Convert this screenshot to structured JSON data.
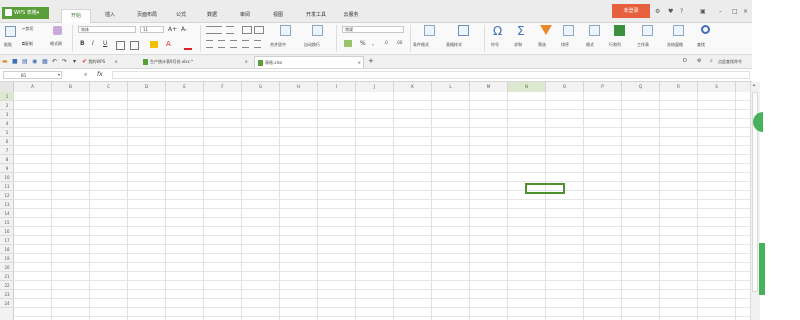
{
  "title_bar": {
    "app_label": "WPS 表格",
    "tabs": [
      "开始",
      "插入",
      "页面布局",
      "公式",
      "数据",
      "审阅",
      "视图",
      "开发工具",
      "云服务"
    ],
    "login_label": "未登录"
  },
  "ribbon": {
    "paste": "粘贴",
    "cut": "剪切",
    "copy": "复制",
    "format_painter": "格式刷",
    "font_name": "宋体",
    "font_size": "11",
    "bold": "B",
    "italic": "I",
    "underline": "U",
    "font_grow": "A+",
    "font_shrink": "A-",
    "merge_center": "合并居中",
    "wrap_text": "自动换行",
    "number_format": "常规",
    "cond_format": "条件格式",
    "table_style": "表格样式",
    "symbol": "符号",
    "autosum": "求和",
    "filter": "筛选",
    "sort": "排序",
    "format": "格式",
    "rows_cols": "行和列",
    "worksheet": "工作表",
    "freeze": "冻结窗格",
    "find": "查找"
  },
  "doc_tabs": {
    "my_wps": "我的WPS",
    "file1": "生产统计表9月份.xlsx *",
    "file2": "表格.xlsx"
  },
  "formula_bar": {
    "cell_ref": "B1",
    "fx": "fx",
    "search_label": "点此查找命令"
  },
  "grid": {
    "columns": [
      "A",
      "B",
      "C",
      "D",
      "E",
      "F",
      "G",
      "H",
      "I",
      "J",
      "K",
      "L",
      "M",
      "N",
      "O",
      "P",
      "Q",
      "R",
      "S"
    ],
    "rows": [
      "1",
      "2",
      "3",
      "4",
      "5",
      "6",
      "7",
      "8",
      "9",
      "10",
      "11",
      "12",
      "13",
      "14",
      "15",
      "16",
      "17",
      "18",
      "19",
      "20",
      "21",
      "22",
      "23",
      "24"
    ],
    "selected_column": "N",
    "selected_row": "1"
  },
  "colors": {
    "accent": "#5a9e3a",
    "login": "#e7603d",
    "selection": "#4e8f2f"
  }
}
